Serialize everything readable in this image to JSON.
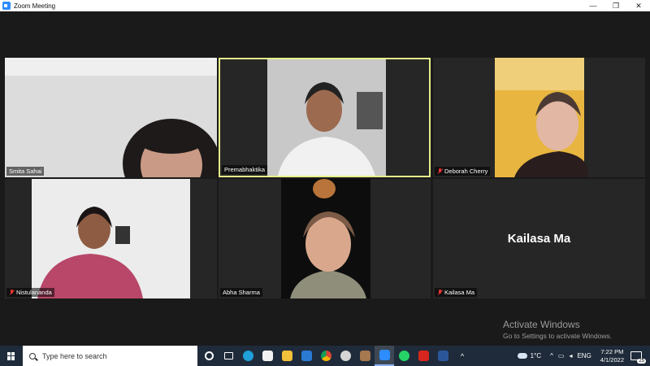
{
  "window": {
    "title": "Zoom Meeting",
    "minimize": "—",
    "restore": "❐",
    "close": "✕"
  },
  "participants": [
    {
      "name": "Smita Sahai",
      "muted": false,
      "active": false
    },
    {
      "name": "Premabhaktika",
      "muted": false,
      "active": true
    },
    {
      "name": "Deborah Cherry",
      "muted": true,
      "active": false
    },
    {
      "name": "Nistulananda",
      "muted": true,
      "active": false
    },
    {
      "name": "Abha Sharma",
      "muted": false,
      "active": false
    },
    {
      "name": "Kailasa Ma",
      "muted": true,
      "active": false,
      "video_off_label": "Kailasa Ma"
    }
  ],
  "watermark": {
    "line1": "Activate Windows",
    "line2": "Go to Settings to activate Windows."
  },
  "taskbar": {
    "search_placeholder": "Type here to search",
    "apps": [
      "cortana-icon",
      "task-view-icon",
      "edge-icon",
      "store-icon",
      "file-explorer-icon",
      "mail-icon",
      "chrome-icon",
      "paint-icon",
      "teams-icon",
      "zoom-icon",
      "whatsapp-icon",
      "acrobat-icon",
      "word-icon"
    ],
    "weather": "1°C",
    "language": "ENG",
    "time": "7:22 PM",
    "date": "4/1/2022",
    "notification_count": "25"
  },
  "colors": {
    "active_speaker_border": "#e6f08a",
    "taskbar": "#1f2b3a",
    "zoom_blue": "#2d8cff"
  }
}
